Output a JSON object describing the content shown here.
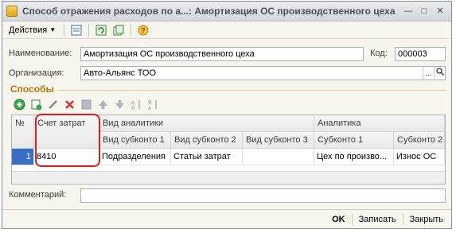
{
  "window": {
    "title": "Способ отражения расходов по а...: Амортизация  ОС производственного цеха",
    "controls": [
      "minimize",
      "maximize",
      "close"
    ]
  },
  "toolbar": {
    "actions_label": "Действия",
    "icons": [
      "list-icon",
      "refresh-icon",
      "copy-icon",
      "help-icon"
    ]
  },
  "form": {
    "name_label": "Наименование:",
    "name_value": "Амортизация  ОС производственного цеха",
    "code_label": "Код:",
    "code_value": "000003",
    "org_label": "Организация:",
    "org_value": "Авто-Альянс ТОО",
    "comment_label": "Комментарий:",
    "comment_value": ""
  },
  "methods": {
    "section_title": "Способы",
    "table": {
      "col_num": "№",
      "col_account": "Счет затрат",
      "group_analytics_type": "Вид аналитики",
      "group_analytics": "Аналитика",
      "sub_type_1": "Вид субконто 1",
      "sub_type_2": "Вид субконто 2",
      "sub_type_3": "Вид субконто 3",
      "sub_1": "Субконто 1",
      "sub_2": "Субконто 2",
      "rows": [
        {
          "num": "1",
          "account": "8410",
          "type1": "Подразделения",
          "type2": "Статьи затрат",
          "type3": "",
          "sub1": "Цех по произво...",
          "sub2": "Износ ОС"
        }
      ]
    }
  },
  "footer": {
    "ok_label": "OK",
    "save_label": "Записать",
    "close_label": "Закрыть"
  },
  "colors": {
    "section_title": "#c0730a",
    "highlight": "#d42020",
    "selected_cell": "#3a6fc7"
  }
}
